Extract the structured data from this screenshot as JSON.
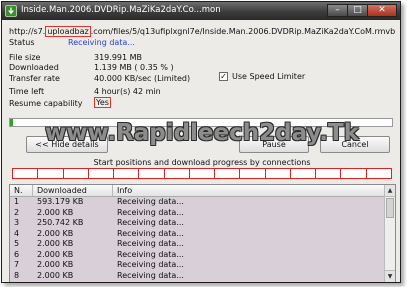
{
  "window": {
    "title": "Inside.Man.2006.DVDRip.MaZiKa2daY.Co...mon",
    "minimize_glyph": "–",
    "maximize_glyph": "□",
    "close_glyph": "✕"
  },
  "url": {
    "prefix": "http://s7.",
    "highlight": "uploadbaz",
    "rest": ".com/files/5/q13ufiplxgnl7e/Inside.Man.2006.DVDRip.MaZiKa2daY.CoM.rmvb"
  },
  "status": {
    "label": "Status",
    "value": "Receiving data..."
  },
  "info": {
    "file_size_label": "File size",
    "file_size_value": "319.991  MB",
    "downloaded_label": "Downloaded",
    "downloaded_value": "1.139  MB  ( 0.35 % )",
    "transfer_rate_label": "Transfer rate",
    "transfer_rate_value": "40.000  KB/sec  (Limited)",
    "time_left_label": "Time left",
    "time_left_value": "4 hour(s) 42 min",
    "resume_label": "Resume capability",
    "resume_value": "Yes"
  },
  "speed_limiter": {
    "label": "Use Speed Limiter",
    "checked": true,
    "check_glyph": "✓"
  },
  "progress": {
    "fraction": 0.0035,
    "fill_color": "#27a81f"
  },
  "buttons": {
    "hide_label": "<< Hide details",
    "pause_label": "Pause",
    "cancel_label": "Cancel"
  },
  "watermark": "www.Rapidleech2day.Tk",
  "connections": {
    "caption": "Start positions and download progress by connections",
    "segments": 15
  },
  "list": {
    "headers": [
      "N.",
      "Downloaded",
      "Info"
    ],
    "rows": [
      {
        "n": "1",
        "downloaded": "593.179  KB",
        "info": "Receiving data..."
      },
      {
        "n": "2",
        "downloaded": "2.000  KB",
        "info": "Receiving data..."
      },
      {
        "n": "3",
        "downloaded": "250.742  KB",
        "info": "Receiving data..."
      },
      {
        "n": "4",
        "downloaded": "2.000  KB",
        "info": "Receiving data..."
      },
      {
        "n": "5",
        "downloaded": "2.000  KB",
        "info": "Receiving data..."
      },
      {
        "n": "6",
        "downloaded": "2.000  KB",
        "info": "Receiving data..."
      },
      {
        "n": "7",
        "downloaded": "2.000  KB",
        "info": "Receiving data..."
      },
      {
        "n": "8",
        "downloaded": "2.000  KB",
        "info": "Receiving data..."
      }
    ],
    "scroll_up_glyph": "▲",
    "scroll_down_glyph": "▼"
  }
}
